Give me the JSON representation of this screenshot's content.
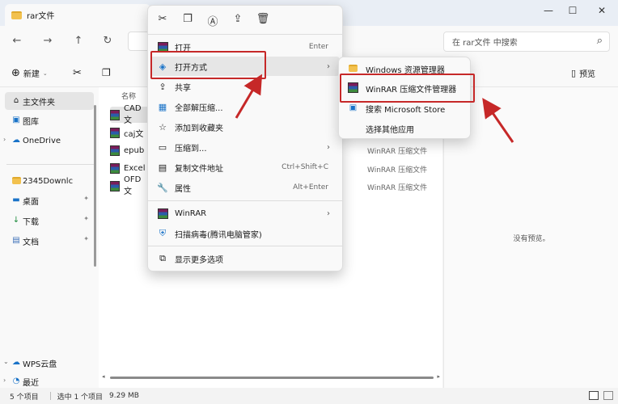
{
  "window": {
    "tab_title": "rar文件",
    "controls": [
      "—",
      "☐",
      "✕"
    ]
  },
  "nav": {
    "search_placeholder": "在 rar文件 中搜索"
  },
  "toolbar": {
    "new_label": "新建",
    "preview_label": "预览"
  },
  "sidebar": {
    "items": [
      {
        "label": "主文件夹",
        "icon": "home-icon"
      },
      {
        "label": "图库",
        "icon": "gallery-icon"
      },
      {
        "label": "OneDrive",
        "icon": "cloud-icon"
      },
      {
        "label": "2345Downlc",
        "icon": "folder-icon"
      },
      {
        "label": "桌面",
        "icon": "desktop-icon"
      },
      {
        "label": "下载",
        "icon": "download-icon"
      },
      {
        "label": "文档",
        "icon": "document-icon"
      },
      {
        "label": "WPS云盘",
        "icon": "cloud-icon"
      },
      {
        "label": "最近",
        "icon": "clock-icon"
      }
    ]
  },
  "files": {
    "column_name": "名称",
    "rows": [
      {
        "name": "CAD文",
        "type": ""
      },
      {
        "name": "caj文",
        "type": "WinRAR 压缩文件"
      },
      {
        "name": "epub",
        "type": "WinRAR 压缩文件"
      },
      {
        "name": "Excel",
        "type": "WinRAR 压缩文件"
      },
      {
        "name": "OFD文",
        "type": "WinRAR 压缩文件"
      }
    ]
  },
  "preview": {
    "empty_text": "没有预览。"
  },
  "status": {
    "count": "5 个项目",
    "selection": "选中 1 个项目",
    "size": "9.29 MB"
  },
  "context_menu": {
    "items": [
      {
        "label": "打开",
        "shortcut": "Enter"
      },
      {
        "label": "打开方式",
        "shortcut": ""
      },
      {
        "label": "共享",
        "shortcut": ""
      },
      {
        "label": "全部解压缩...",
        "shortcut": ""
      },
      {
        "label": "添加到收藏夹",
        "shortcut": ""
      },
      {
        "label": "压缩到...",
        "shortcut": ""
      },
      {
        "label": "复制文件地址",
        "shortcut": "Ctrl+Shift+C"
      },
      {
        "label": "属性",
        "shortcut": "Alt+Enter"
      },
      {
        "label": "WinRAR",
        "shortcut": ""
      },
      {
        "label": "扫描病毒(腾讯电脑管家)",
        "shortcut": ""
      },
      {
        "label": "显示更多选项",
        "shortcut": ""
      }
    ]
  },
  "submenu": {
    "items": [
      {
        "label": "Windows 资源管理器"
      },
      {
        "label": "WinRAR 压缩文件管理器"
      },
      {
        "label": "搜索 Microsoft Store"
      },
      {
        "label": "选择其他应用"
      }
    ]
  },
  "colors": {
    "highlight_box": "#c62828",
    "accent": "#0067c0"
  }
}
